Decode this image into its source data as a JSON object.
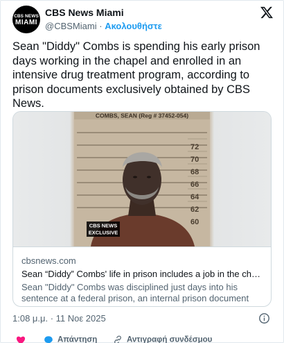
{
  "header": {
    "avatar_line1": "CBS NEWS",
    "avatar_line2": "MIAMI",
    "display_name": "CBS News Miami",
    "handle": "@CBSMiami",
    "separator": "·",
    "follow_label": "Ακολουθήστε"
  },
  "tweet": {
    "text": "Sean \"Diddy\" Combs is spending his early prison days working in the chapel and enrolled in an intensive drug treatment program, according to prison documents exclusively obtained by CBS News."
  },
  "media": {
    "placard_text": "COMBS, SEAN (Reg # 37452-054)",
    "height_marks": [
      "72",
      "70",
      "68",
      "66",
      "64",
      "62",
      "60"
    ],
    "badge_brand": "CBS NEWS",
    "badge_label": "EXCLUSIVE"
  },
  "card": {
    "domain": "cbsnews.com",
    "title": "Sean “Diddy” Combs' life in prison includes a job in the chapel, d...",
    "description": "Sean \"Diddy\" Combs was disciplined just days into his sentence at a federal prison, an internal prison document obtained by CBS ..."
  },
  "footer": {
    "timestamp": "1:08 μ.μ. · 11 Νοε 2025",
    "reply_label": "Απάντηση",
    "copy_link_label": "Αντιγραφή συνδέσμου"
  },
  "colors": {
    "accent": "#1d9bf0",
    "like": "#f91880",
    "secondary_text": "#536471"
  }
}
